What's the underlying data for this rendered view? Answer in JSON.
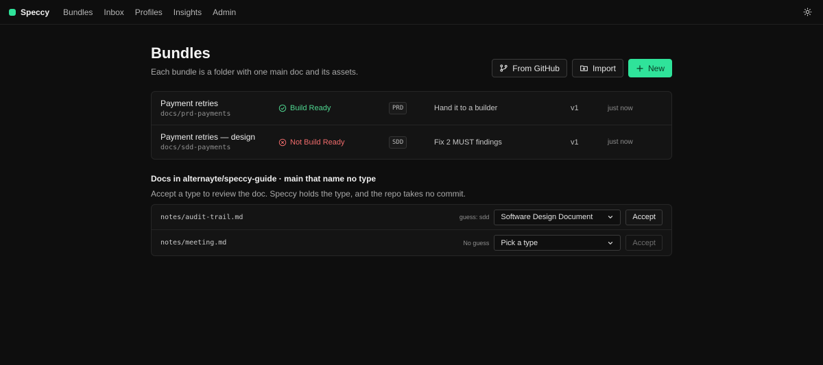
{
  "nav": {
    "brand": "Speccy",
    "links": [
      "Bundles",
      "Inbox",
      "Profiles",
      "Insights",
      "Admin"
    ],
    "theme_icon": "sun-icon"
  },
  "page": {
    "title": "Bundles",
    "subtitle": "Each bundle is a folder with one main doc and its assets.",
    "actions": {
      "from_github": "From GitHub",
      "import": "Import",
      "new": "New"
    }
  },
  "bundles": [
    {
      "name": "Payment retries",
      "path": "docs/prd-payments",
      "status": "Build Ready",
      "status_kind": "ok",
      "type": "PRD",
      "next": "Hand it to a builder",
      "version": "v1",
      "updated": "just now"
    },
    {
      "name": "Payment retries — design",
      "path": "docs/sdd-payments",
      "status": "Not Build Ready",
      "status_kind": "bad",
      "type": "SDD",
      "next": "Fix 2 MUST findings",
      "version": "v1",
      "updated": "just now"
    }
  ],
  "docs_section": {
    "title": "Docs in alternayte/speccy-guide · main that name no type",
    "subtitle": "Accept a type to review the doc. Speccy holds the type, and the repo takes no commit.",
    "rows": [
      {
        "path": "notes/audit-trail.md",
        "guess": "guess: sdd",
        "selected": "Software Design Document",
        "accept": "Accept",
        "accept_enabled": true
      },
      {
        "path": "notes/meeting.md",
        "guess": "No guess",
        "selected": "Pick a type",
        "accept": "Accept",
        "accept_enabled": false
      }
    ]
  },
  "colors": {
    "accent": "#2fe39a",
    "ok": "#4fd690",
    "bad": "#ef6b6b",
    "background": "#0e0e0e"
  }
}
